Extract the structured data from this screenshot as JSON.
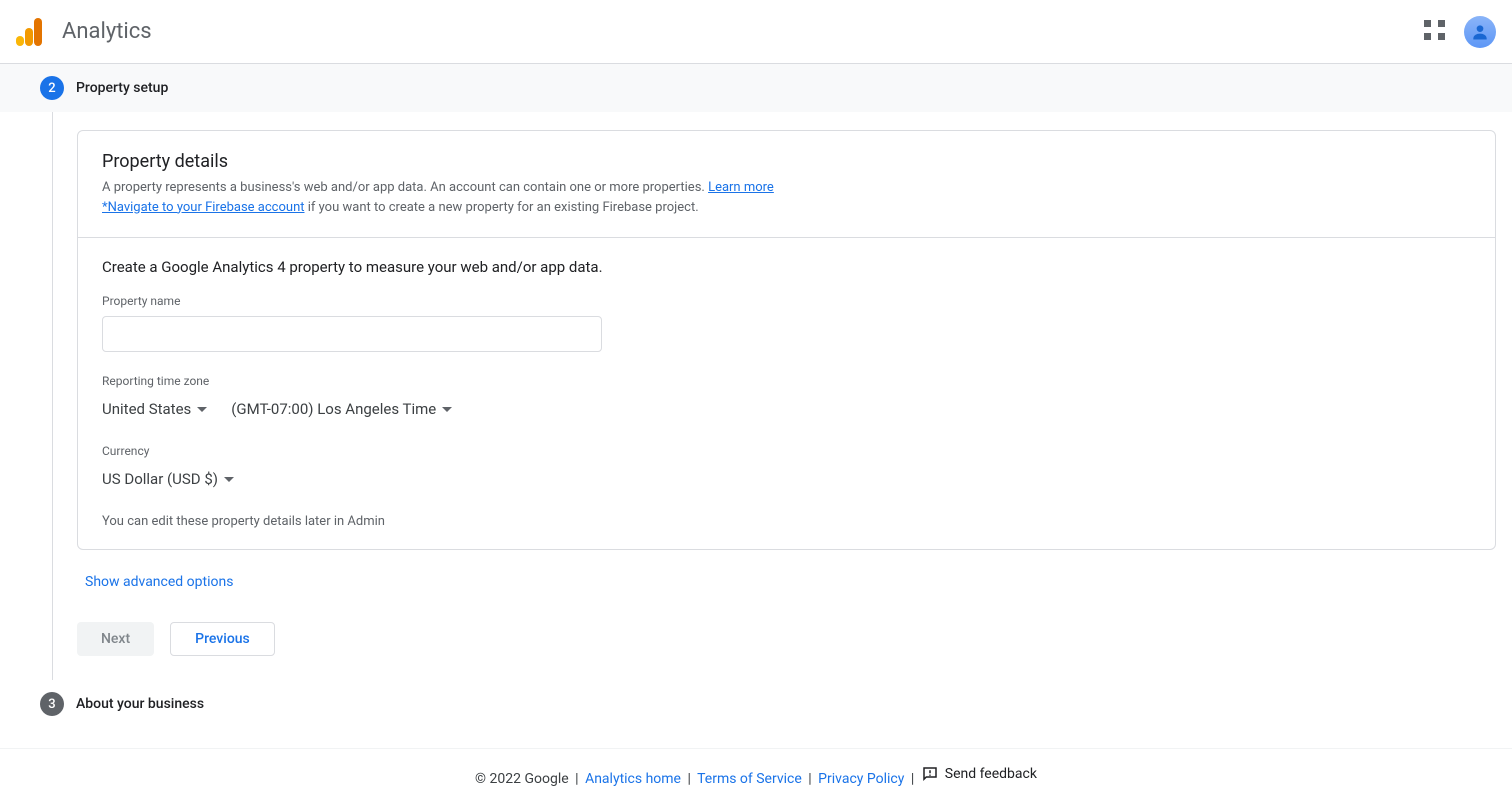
{
  "header": {
    "app_title": "Analytics"
  },
  "steps": {
    "step2": {
      "number": "2",
      "title": "Property setup"
    },
    "step3": {
      "number": "3",
      "title": "About your business"
    }
  },
  "property_details": {
    "title": "Property details",
    "desc_part1": "A property represents a business's web and/or app data. An account can contain one or more properties. ",
    "learn_more": "Learn more",
    "firebase_link": "*Navigate to your Firebase account",
    "desc_part2": " if you want to create a new property for an existing Firebase project."
  },
  "form": {
    "heading": "Create a Google Analytics 4 property to measure your web and/or app data.",
    "property_name_label": "Property name",
    "property_name_value": "",
    "timezone_label": "Reporting time zone",
    "country_value": "United States",
    "tz_value": "(GMT-07:00) Los Angeles Time",
    "currency_label": "Currency",
    "currency_value": "US Dollar (USD $)",
    "hint": "You can edit these property details later in Admin"
  },
  "advanced_label": "Show advanced options",
  "buttons": {
    "next": "Next",
    "previous": "Previous"
  },
  "footer": {
    "copyright": "© 2022 Google",
    "analytics_home": "Analytics home",
    "tos": "Terms of Service",
    "privacy": "Privacy Policy",
    "feedback": "Send feedback"
  }
}
